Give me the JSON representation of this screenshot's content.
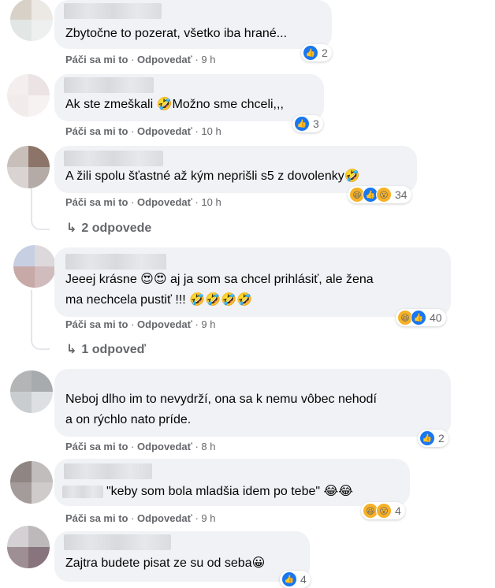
{
  "actions": {
    "like": "Páči sa mi to",
    "dot": " · ",
    "reply": "Odpovedať"
  },
  "comments": [
    {
      "text": "Zbytočne to pozerat, všetko iba hrané...",
      "time": "9 h",
      "count": "2",
      "reactions": [
        "like-icon"
      ]
    },
    {
      "text": "Ak ste zmeškali 🤣Možno sme chceli,,,",
      "time": "10 h",
      "count": "3",
      "reactions": [
        "like-icon"
      ]
    },
    {
      "text": "A žili spolu šťastné až kým neprišli s5 z dovolenky🤣",
      "time": "10 h",
      "count": "34",
      "reactions": [
        "haha-icon",
        "like-icon",
        "wow-icon"
      ],
      "replies": "2 odpovede"
    },
    {
      "text_line1": "Jeeej krásne 😍😍 aj ja som sa chcel prihlásiť, ale žena",
      "text_line2": "ma nechcela pustiť !!! 🤣🤣🤣🤣",
      "time": "9 h",
      "count": "40",
      "reactions": [
        "haha-icon",
        "like-icon"
      ],
      "replies": "1 odpoveď"
    },
    {
      "text_line1": "Neboj dlho im to nevydrží, ona sa k nemu vôbec nehodí",
      "text_line2": "a on rýchlo nato príde.",
      "time": "8 h",
      "count": "2",
      "reactions": [
        "like-icon"
      ]
    },
    {
      "text": "\"keby som bola mladšia idem po tebe\" 😂😂",
      "time": "9 h",
      "count": "4",
      "reactions": [
        "haha-icon",
        "wow-icon"
      ]
    },
    {
      "text": "Zajtra budete pisat ze su od seba😀",
      "count": "4"
    }
  ],
  "colors": {
    "like": "#1877f2",
    "haha": "#f7b125",
    "bubble": "#f0f2f5",
    "meta": "#65676b"
  }
}
